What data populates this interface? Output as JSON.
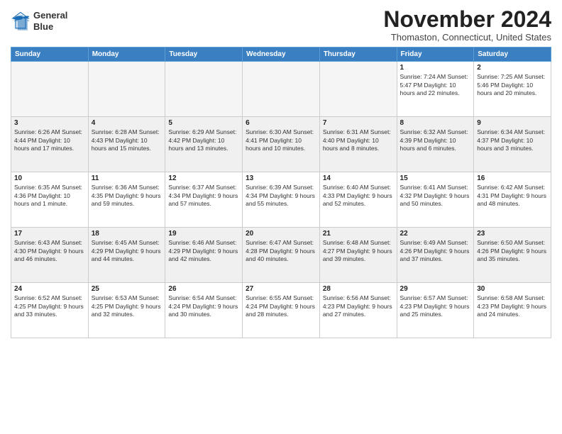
{
  "logo": {
    "line1": "General",
    "line2": "Blue"
  },
  "title": "November 2024",
  "location": "Thomaston, Connecticut, United States",
  "headers": [
    "Sunday",
    "Monday",
    "Tuesday",
    "Wednesday",
    "Thursday",
    "Friday",
    "Saturday"
  ],
  "weeks": [
    [
      {
        "day": "",
        "info": "",
        "empty": true
      },
      {
        "day": "",
        "info": "",
        "empty": true
      },
      {
        "day": "",
        "info": "",
        "empty": true
      },
      {
        "day": "",
        "info": "",
        "empty": true
      },
      {
        "day": "",
        "info": "",
        "empty": true
      },
      {
        "day": "1",
        "info": "Sunrise: 7:24 AM\nSunset: 5:47 PM\nDaylight: 10 hours and 22 minutes."
      },
      {
        "day": "2",
        "info": "Sunrise: 7:25 AM\nSunset: 5:46 PM\nDaylight: 10 hours and 20 minutes."
      }
    ],
    [
      {
        "day": "3",
        "info": "Sunrise: 6:26 AM\nSunset: 4:44 PM\nDaylight: 10 hours and 17 minutes."
      },
      {
        "day": "4",
        "info": "Sunrise: 6:28 AM\nSunset: 4:43 PM\nDaylight: 10 hours and 15 minutes."
      },
      {
        "day": "5",
        "info": "Sunrise: 6:29 AM\nSunset: 4:42 PM\nDaylight: 10 hours and 13 minutes."
      },
      {
        "day": "6",
        "info": "Sunrise: 6:30 AM\nSunset: 4:41 PM\nDaylight: 10 hours and 10 minutes."
      },
      {
        "day": "7",
        "info": "Sunrise: 6:31 AM\nSunset: 4:40 PM\nDaylight: 10 hours and 8 minutes."
      },
      {
        "day": "8",
        "info": "Sunrise: 6:32 AM\nSunset: 4:39 PM\nDaylight: 10 hours and 6 minutes."
      },
      {
        "day": "9",
        "info": "Sunrise: 6:34 AM\nSunset: 4:37 PM\nDaylight: 10 hours and 3 minutes."
      }
    ],
    [
      {
        "day": "10",
        "info": "Sunrise: 6:35 AM\nSunset: 4:36 PM\nDaylight: 10 hours and 1 minute."
      },
      {
        "day": "11",
        "info": "Sunrise: 6:36 AM\nSunset: 4:35 PM\nDaylight: 9 hours and 59 minutes."
      },
      {
        "day": "12",
        "info": "Sunrise: 6:37 AM\nSunset: 4:34 PM\nDaylight: 9 hours and 57 minutes."
      },
      {
        "day": "13",
        "info": "Sunrise: 6:39 AM\nSunset: 4:34 PM\nDaylight: 9 hours and 55 minutes."
      },
      {
        "day": "14",
        "info": "Sunrise: 6:40 AM\nSunset: 4:33 PM\nDaylight: 9 hours and 52 minutes."
      },
      {
        "day": "15",
        "info": "Sunrise: 6:41 AM\nSunset: 4:32 PM\nDaylight: 9 hours and 50 minutes."
      },
      {
        "day": "16",
        "info": "Sunrise: 6:42 AM\nSunset: 4:31 PM\nDaylight: 9 hours and 48 minutes."
      }
    ],
    [
      {
        "day": "17",
        "info": "Sunrise: 6:43 AM\nSunset: 4:30 PM\nDaylight: 9 hours and 46 minutes."
      },
      {
        "day": "18",
        "info": "Sunrise: 6:45 AM\nSunset: 4:29 PM\nDaylight: 9 hours and 44 minutes."
      },
      {
        "day": "19",
        "info": "Sunrise: 6:46 AM\nSunset: 4:29 PM\nDaylight: 9 hours and 42 minutes."
      },
      {
        "day": "20",
        "info": "Sunrise: 6:47 AM\nSunset: 4:28 PM\nDaylight: 9 hours and 40 minutes."
      },
      {
        "day": "21",
        "info": "Sunrise: 6:48 AM\nSunset: 4:27 PM\nDaylight: 9 hours and 39 minutes."
      },
      {
        "day": "22",
        "info": "Sunrise: 6:49 AM\nSunset: 4:26 PM\nDaylight: 9 hours and 37 minutes."
      },
      {
        "day": "23",
        "info": "Sunrise: 6:50 AM\nSunset: 4:26 PM\nDaylight: 9 hours and 35 minutes."
      }
    ],
    [
      {
        "day": "24",
        "info": "Sunrise: 6:52 AM\nSunset: 4:25 PM\nDaylight: 9 hours and 33 minutes."
      },
      {
        "day": "25",
        "info": "Sunrise: 6:53 AM\nSunset: 4:25 PM\nDaylight: 9 hours and 32 minutes."
      },
      {
        "day": "26",
        "info": "Sunrise: 6:54 AM\nSunset: 4:24 PM\nDaylight: 9 hours and 30 minutes."
      },
      {
        "day": "27",
        "info": "Sunrise: 6:55 AM\nSunset: 4:24 PM\nDaylight: 9 hours and 28 minutes."
      },
      {
        "day": "28",
        "info": "Sunrise: 6:56 AM\nSunset: 4:23 PM\nDaylight: 9 hours and 27 minutes."
      },
      {
        "day": "29",
        "info": "Sunrise: 6:57 AM\nSunset: 4:23 PM\nDaylight: 9 hours and 25 minutes."
      },
      {
        "day": "30",
        "info": "Sunrise: 6:58 AM\nSunset: 4:23 PM\nDaylight: 9 hours and 24 minutes."
      }
    ]
  ]
}
